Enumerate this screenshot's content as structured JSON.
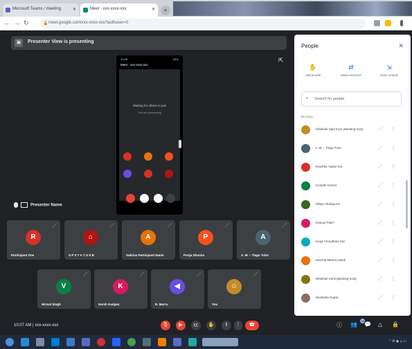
{
  "browser": {
    "tabs": [
      {
        "label": "Microsoft Teams / meeting",
        "fav_color": "#5b5fc7"
      },
      {
        "label": "Meet - xxx-xxxx-xxx",
        "fav_color": "#00897b"
      }
    ],
    "url": "meet.google.com/xxx-xxxx-xxx?authuser=0",
    "new_tab": "+"
  },
  "presentation": {
    "banner": "Presenter View is presenting",
    "presenter_label": "Presenter Name",
    "phone": {
      "time": "12:05",
      "battery": "54%",
      "title": "Meet · xxx-xxxx-xxx",
      "waiting": "Waiting for others to join",
      "waiting2": "You are presenting"
    }
  },
  "tiles_row1": [
    {
      "name": "Participant One",
      "initial": "R",
      "color": "#d93025"
    },
    {
      "name": "S P S T A T U S B",
      "initial": "⌂",
      "color": "#b31412"
    },
    {
      "name": "Sabrina Participant Name",
      "initial": "A",
      "color": "#e8710a"
    },
    {
      "name": "Pooja Sharma",
      "initial": "P",
      "color": "#f4511e"
    },
    {
      "name": "A. M. – Tiago Tutor",
      "initial": "A",
      "color": "#4a6572"
    }
  ],
  "tiles_row2": [
    {
      "name": "Nirmal Singh",
      "initial": "V",
      "color": "#0b8043"
    },
    {
      "name": "Harsh Kunjam",
      "initial": "K",
      "color": "#d81b60"
    },
    {
      "name": "D. Murru",
      "initial": "◀",
      "color": "#6b4ce6"
    },
    {
      "name": "You",
      "initial": "☺",
      "color": "#c58a2a"
    }
  ],
  "controls": {
    "time": "10:07 AM",
    "meeting_code": "xxx-xxxx-xxx",
    "end_label": "☎",
    "participant_count": "16"
  },
  "people_panel": {
    "title": "People",
    "close": "✕",
    "actions": [
      {
        "icon": "✋",
        "label": "Add people"
      },
      {
        "icon": "⇄",
        "label": "Mute everyone"
      },
      {
        "icon": "⇲",
        "label": "Host controls"
      }
    ],
    "search_placeholder": "Search for people",
    "section_label": "IN CALL",
    "participants": [
      {
        "name": "Abhishek Sabi Kore (Meeting host)",
        "color": "#c58a2a"
      },
      {
        "name": "A. M. – Tiago Tutor",
        "color": "#4a6572"
      },
      {
        "name": "Anushka Yadav Kat",
        "color": "#d93025"
      },
      {
        "name": "Arvinder Kumar",
        "color": "#0b8043"
      },
      {
        "name": "Aditya Hinduja Ka",
        "color": "#33691e"
      },
      {
        "name": "Ananya Patel",
        "color": "#d81b60"
      },
      {
        "name": "Anuja Choudhary Kat",
        "color": "#00acc1"
      },
      {
        "name": "Aanchal Mishra Harsh",
        "color": "#e8710a"
      },
      {
        "name": "Abhishek Kohli (Meeting host)",
        "color": "#827717"
      },
      {
        "name": "Akanksha Gupta",
        "color": "#8d6e63"
      }
    ]
  }
}
